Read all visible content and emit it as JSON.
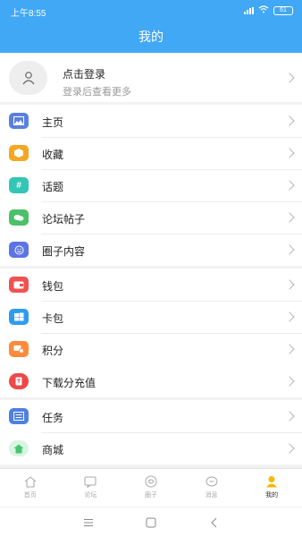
{
  "status_bar": {
    "time": "上午8:55",
    "battery": "61"
  },
  "header": {
    "title": "我的"
  },
  "login": {
    "title": "点击登录",
    "subtitle": "登录后查看更多"
  },
  "menu": {
    "group1": [
      {
        "label": "主页",
        "icon": "picture-icon",
        "color": "#5b7fe0"
      },
      {
        "label": "收藏",
        "icon": "box-icon",
        "color": "#f5a623"
      },
      {
        "label": "话题",
        "icon": "hashtag-icon",
        "color": "#34c6b4"
      },
      {
        "label": "论坛帖子",
        "icon": "chat-bubbles-icon",
        "color": "#4cc06a"
      },
      {
        "label": "圈子内容",
        "icon": "smile-icon",
        "color": "#5c74e6"
      }
    ],
    "group2": [
      {
        "label": "钱包",
        "icon": "wallet-icon",
        "color": "#f05151"
      },
      {
        "label": "卡包",
        "icon": "cards-icon",
        "color": "#2f9bef"
      },
      {
        "label": "积分",
        "icon": "points-icon",
        "color": "#ff8a3d"
      }
    ],
    "group3": [
      {
        "label": "下载分充值",
        "icon": "download-coin-icon",
        "color": "#ee4848"
      }
    ],
    "group4": [
      {
        "label": "任务",
        "icon": "task-list-icon",
        "color": "#4f7fe0"
      },
      {
        "label": "商城",
        "icon": "shop-icon",
        "color": "#46c46f"
      }
    ]
  },
  "tabs": [
    {
      "label": "首页",
      "icon": "home-icon",
      "active": false
    },
    {
      "label": "论坛",
      "icon": "forum-icon",
      "active": false
    },
    {
      "label": "圈子",
      "icon": "circle-icon",
      "active": false
    },
    {
      "label": "消息",
      "icon": "message-icon",
      "active": false
    },
    {
      "label": "我的",
      "icon": "profile-icon",
      "active": true
    }
  ],
  "colors": {
    "primary": "#41a8f5",
    "active_tab": "#f5b800"
  }
}
